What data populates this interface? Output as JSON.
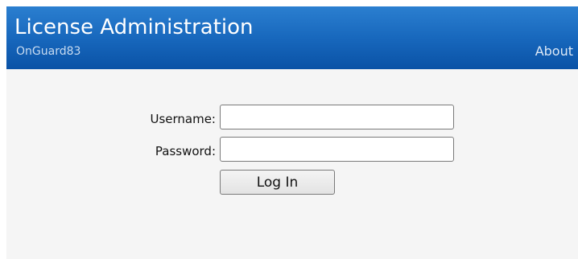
{
  "header": {
    "title": "License Administration",
    "subtitle": "OnGuard83",
    "about_link": "About"
  },
  "login_form": {
    "username_label": "Username:",
    "username_value": "",
    "password_label": "Password:",
    "password_value": "",
    "login_button": "Log In"
  },
  "colors": {
    "header_blue": "#1868bd",
    "content_background": "#f5f5f5"
  }
}
